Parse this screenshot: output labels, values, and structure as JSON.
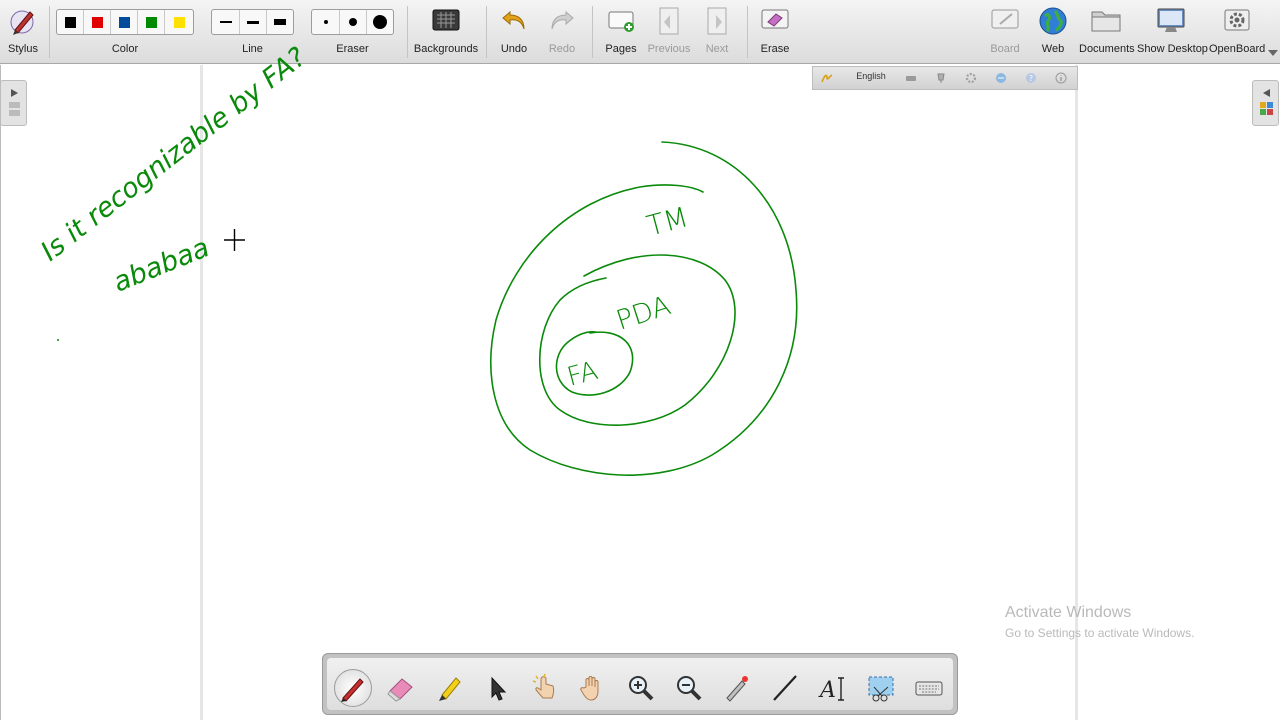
{
  "toolbar": {
    "stylus": "Stylus",
    "color": "Color",
    "line": "Line",
    "eraser": "Eraser",
    "backgrounds": "Backgrounds",
    "undo": "Undo",
    "redo": "Redo",
    "pages": "Pages",
    "previous": "Previous",
    "next": "Next",
    "erase": "Erase",
    "board": "Board",
    "web": "Web",
    "documents": "Documents",
    "show_desktop": "Show Desktop",
    "openboard": "OpenBoard",
    "colors": [
      "#000000",
      "#e00000",
      "#004a9c",
      "#008a00",
      "#ffe000"
    ]
  },
  "palette_strip": {
    "language": "English"
  },
  "board": {
    "ink_color": "#0a8a0a",
    "question": "Is it recognizable by FA?",
    "word": "ababaa",
    "labels": {
      "tm": "TM",
      "pda": "PDA",
      "fa": "FA"
    }
  },
  "watermark": {
    "title": "Activate Windows",
    "subtitle": "Go to Settings to activate Windows."
  },
  "bottom_tools": [
    "pen",
    "eraser",
    "marker",
    "selector",
    "play",
    "hand",
    "zoom-in",
    "zoom-out",
    "laser-pointer",
    "line",
    "text",
    "capture",
    "virtual-keyboard"
  ]
}
